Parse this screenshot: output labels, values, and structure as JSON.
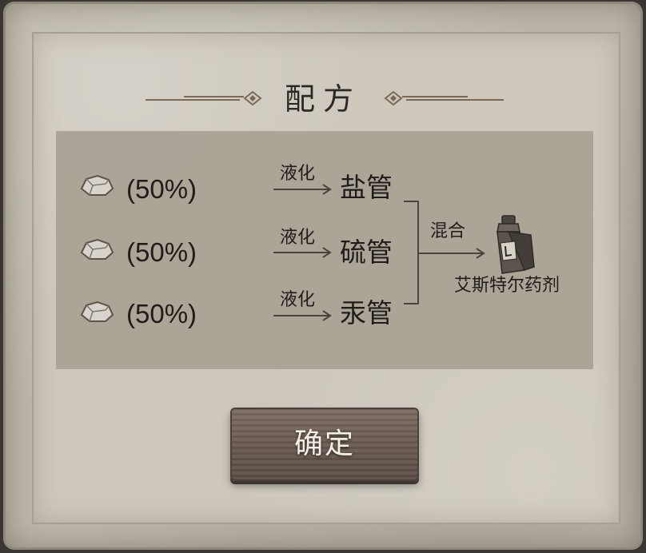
{
  "dialog": {
    "title": "配方",
    "confirm_label": "确定"
  },
  "recipe": {
    "inputs": [
      {
        "icon": "ore-rock-icon",
        "percent": "(50%)",
        "process": "液化",
        "product": "盐管"
      },
      {
        "icon": "ore-rock-icon",
        "percent": "(50%)",
        "process": "液化",
        "product": "硫管"
      },
      {
        "icon": "ore-rock-icon",
        "percent": "(50%)",
        "process": "液化",
        "product": "汞管"
      }
    ],
    "combine_label": "混合",
    "result": {
      "icon": "potion-bottle-icon",
      "name": "艾斯特尔药剂"
    }
  },
  "colors": {
    "parchment": "#cdc7bc",
    "panel": "#a8a194",
    "text": "#1f1c19",
    "button_wood": "#6a5c52",
    "button_text": "#f4efe7"
  }
}
